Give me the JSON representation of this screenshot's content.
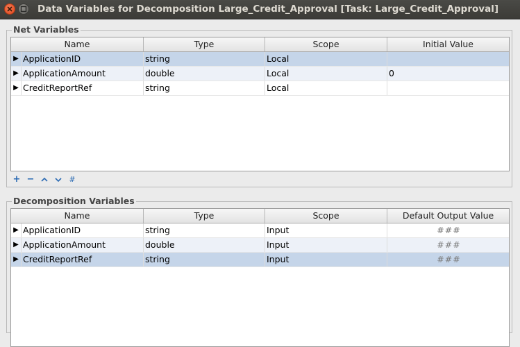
{
  "window": {
    "title": "Data Variables for Decomposition Large_Credit_Approval [Task: Large_Credit_Approval]"
  },
  "net_variables": {
    "group_title": "Net Variables",
    "columns": [
      "Name",
      "Type",
      "Scope",
      "Initial Value"
    ],
    "rows": [
      {
        "name": "ApplicationID",
        "type": "string",
        "scope": "Local",
        "value": ""
      },
      {
        "name": "ApplicationAmount",
        "type": "double",
        "scope": "Local",
        "value": "0"
      },
      {
        "name": "CreditReportRef",
        "type": "string",
        "scope": "Local",
        "value": ""
      }
    ],
    "toolbar": {
      "add": "+",
      "remove": "−",
      "up": "⌃",
      "down": "⌄",
      "format": "#"
    }
  },
  "decomposition_variables": {
    "group_title": "Decomposition Variables",
    "columns": [
      "Name",
      "Type",
      "Scope",
      "Default Output Value"
    ],
    "rows": [
      {
        "name": "ApplicationID",
        "type": "string",
        "scope": "Input",
        "value": "###"
      },
      {
        "name": "ApplicationAmount",
        "type": "double",
        "scope": "Input",
        "value": "###"
      },
      {
        "name": "CreditReportRef",
        "type": "string",
        "scope": "Input",
        "value": "###"
      }
    ]
  },
  "row_marker": "▶"
}
